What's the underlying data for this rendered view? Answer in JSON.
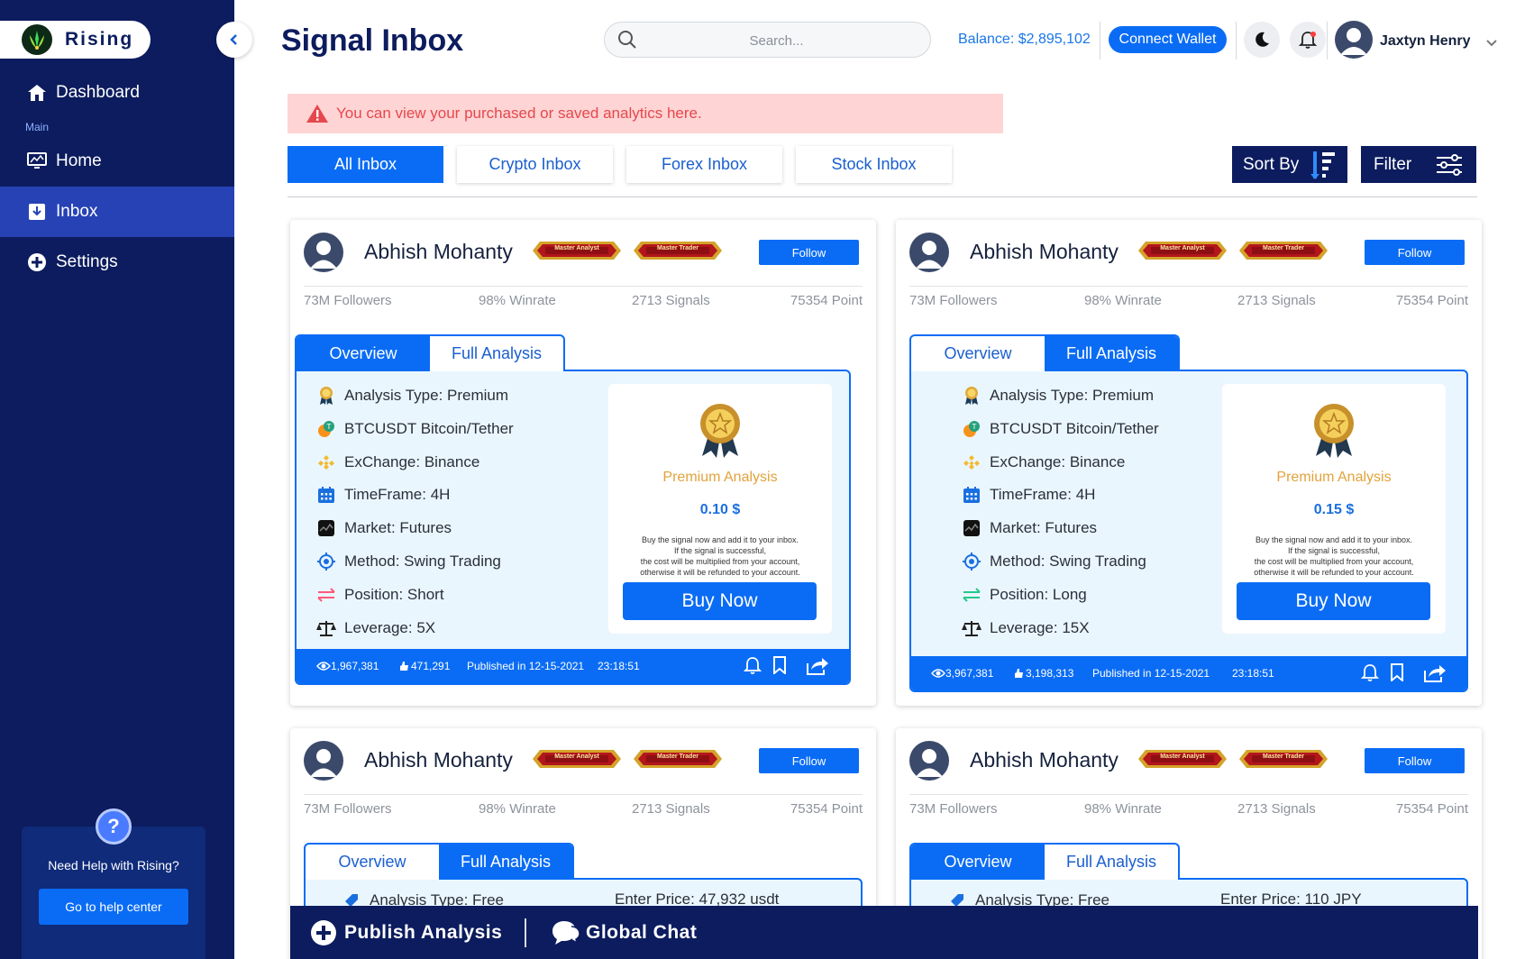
{
  "app": {
    "name": "Rising",
    "page_title": "Signal Inbox"
  },
  "sidebar": {
    "dashboard_label": "Dashboard",
    "section_label": "Main",
    "items": [
      {
        "label": "Home",
        "icon": "monitor-icon"
      },
      {
        "label": "Inbox",
        "icon": "inbox-icon",
        "active": true
      },
      {
        "label": "Settings",
        "icon": "plus-circle-icon"
      }
    ],
    "help": {
      "text": "Need Help with Rising?",
      "button": "Go to help center"
    }
  },
  "header": {
    "search_placeholder": "Search...",
    "balance": "Balance: $2,895,102",
    "connect_wallet": "Connect Wallet",
    "user_name": "Jaxtyn Henry"
  },
  "notice": "You can view your purchased or saved analytics here.",
  "inbox_tabs": [
    "All Inbox",
    "Crypto Inbox",
    "Forex Inbox",
    "Stock Inbox"
  ],
  "controls": {
    "sort_by": "Sort By",
    "filter": "Filter"
  },
  "cards": [
    {
      "name": "Abhish Mohanty",
      "badges": [
        "Master Analyst",
        "Master Trader"
      ],
      "follow": "Follow",
      "stats": [
        "73M Followers",
        "98% Winrate",
        "2713 Signals",
        "75354 Point"
      ],
      "tabs": [
        "Overview",
        "Full Analysis"
      ],
      "active_tab": 0,
      "details": [
        "Analysis Type: Premium",
        "BTCUSDT Bitcoin/Tether",
        "ExChange: Binance",
        "TimeFrame: 4H",
        "Market: Futures",
        "Method: Swing Trading",
        "Position: Short",
        "Leverage: 5X"
      ],
      "buy": {
        "title": "Premium Analysis",
        "price": "0.10 $",
        "desc": [
          "Buy the signal now and add it to your inbox.",
          "If the signal is successful,",
          "the cost will be multiplied from your account,",
          "otherwise it will be refunded to your account."
        ],
        "button": "Buy Now"
      },
      "footer": {
        "views": "1,967,381",
        "likes": "471,291",
        "published": "Published in 12-15-2021",
        "time": "23:18:51"
      }
    },
    {
      "name": "Abhish Mohanty",
      "badges": [
        "Master Analyst",
        "Master Trader"
      ],
      "follow": "Follow",
      "stats": [
        "73M Followers",
        "98% Winrate",
        "2713 Signals",
        "75354 Point"
      ],
      "tabs": [
        "Overview",
        "Full Analysis"
      ],
      "active_tab": 1,
      "details": [
        "Analysis Type: Premium",
        "BTCUSDT Bitcoin/Tether",
        "ExChange: Binance",
        "TimeFrame: 4H",
        "Market: Futures",
        "Method: Swing Trading",
        "Position: Long",
        "Leverage: 15X"
      ],
      "buy": {
        "title": "Premium Analysis",
        "price": "0.15 $",
        "desc": [
          "Buy the signal now and add it to your inbox.",
          "If the signal is successful,",
          "the cost will be multiplied from your account,",
          "otherwise it will be refunded to your account."
        ],
        "button": "Buy Now"
      },
      "footer": {
        "views": "3,967,381",
        "likes": "3,198,313",
        "published": "Published in 12-15-2021",
        "time": "23:18:51"
      }
    },
    {
      "name": "Abhish Mohanty",
      "badges": [
        "Master Analyst",
        "Master Trader"
      ],
      "follow": "Follow",
      "stats": [
        "73M Followers",
        "98% Winrate",
        "2713 Signals",
        "75354 Point"
      ],
      "tabs": [
        "Overview",
        "Full Analysis"
      ],
      "active_tab": 1,
      "partial": [
        "Analysis Type: Free",
        "Enter Price: 47,932 usdt"
      ]
    },
    {
      "name": "Abhish Mohanty",
      "badges": [
        "Master Analyst",
        "Master Trader"
      ],
      "follow": "Follow",
      "stats": [
        "73M Followers",
        "98% Winrate",
        "2713 Signals",
        "75354 Point"
      ],
      "tabs": [
        "Overview",
        "Full Analysis"
      ],
      "active_tab": 0,
      "partial": [
        "Analysis Type: Free",
        "Enter Price: 110 JPY"
      ]
    }
  ],
  "bottom_bar": {
    "publish": "Publish Analysis",
    "chat": "Global Chat"
  },
  "colors": {
    "sidebar": "#0c1c5e",
    "accent": "#0a6cf5",
    "active_nav": "#2742b5",
    "panel_bg": "#eaf6fe",
    "notice_bg": "#ffd4d4",
    "notice_text": "#e5484d"
  }
}
